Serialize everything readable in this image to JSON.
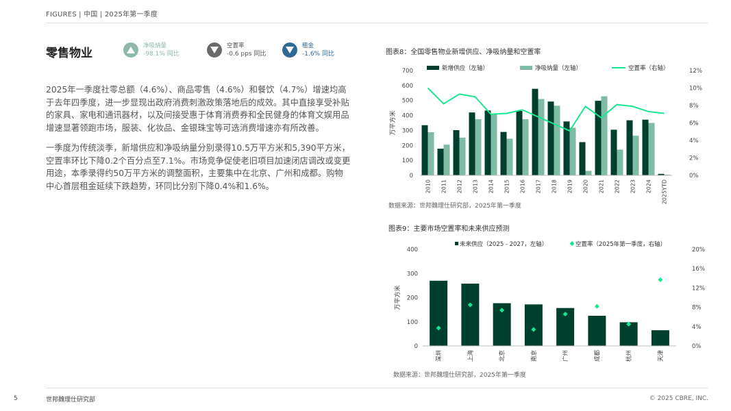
{
  "header": {
    "text": "FIGURES  | 中国 |  2025年第一季度"
  },
  "section_title": "零售物业",
  "kpis": [
    {
      "label": "净吸纳量",
      "value": "-98.1% 同比",
      "color": "#8fb8ad",
      "direction": "up"
    },
    {
      "label": "空置率",
      "value": "-0.6 pps 同比",
      "color": "#6b6b6b",
      "direction": "down"
    },
    {
      "label": "租金",
      "value": "-1.6% 同比",
      "color": "#2f6a96",
      "direction": "down"
    }
  ],
  "paragraphs": [
    "2025年一季度社零总额（4.6%）、商品零售（4.6%）和餐饮（4.7%）增速均高于去年四季度，进一步显现出政府消费刺激政策落地后的成效。其中直接享受补贴的家具、家电和通讯器材，以及间接受惠于体育消费券和全民健身的体育文娱用品增速显著领跑市场，服装、化妆品、金银珠宝等可选消费增速亦有所改善。",
    "一季度为传统淡季，新增供应和净吸纳量分别录得10.5万平方米和5,390平方米，空置率环比下降0.2个百分点至7.1%。市场竞争促使老旧项目加速闭店调改或变更用途，本季录得约50万平方米的调整面积，主要集中在北京、广州和成都。购物中心首层租金延续下跌趋势，环同比分别下降0.4%和1.6%。"
  ],
  "chart1": {
    "title": "图表8：全国零售物业新增供应、净吸纳量和空置率",
    "source": "数据来源：世邦魏理仕研究部，2025年第一季度"
  },
  "chart2": {
    "title": "图表9：主要市场空置率和未来供应预测",
    "source": "数据来源：世邦魏理仕研究部，2025年第一季度"
  },
  "footer": {
    "page": "5",
    "left": "世邦魏理仕研究部",
    "right": "© 2025 CBRE, INC."
  },
  "colors": {
    "dark_green": "#003f2d",
    "light_green": "#80bba6",
    "accent_green": "#17e88f"
  },
  "chart_data": [
    {
      "type": "bar",
      "title": "图表8：全国零售物业新增供应、净吸纳量和空置率",
      "categories": [
        "2010",
        "2011",
        "2012",
        "2013",
        "2014",
        "2015",
        "2016",
        "2017",
        "2018",
        "2019",
        "2020",
        "2021",
        "2022",
        "2023",
        "2024",
        "2025YTD"
      ],
      "series": [
        {
          "name": "新增供应（左轴）",
          "axis": "left",
          "type": "bar",
          "values": [
            335,
            178,
            302,
            420,
            433,
            290,
            430,
            578,
            493,
            360,
            222,
            498,
            305,
            368,
            372,
            10
          ]
        },
        {
          "name": "净吸纳量（左轴）",
          "axis": "left",
          "type": "bar",
          "values": [
            288,
            205,
            252,
            375,
            412,
            245,
            375,
            510,
            465,
            318,
            30,
            528,
            172,
            265,
            350,
            5
          ]
        },
        {
          "name": "空置率（右轴）",
          "axis": "right",
          "type": "line",
          "values": [
            10.0,
            8.2,
            9.3,
            9.0,
            7.0,
            7.1,
            7.5,
            6.7,
            5.9,
            5.1,
            7.9,
            6.6,
            8.1,
            7.9,
            7.3,
            7.1
          ]
        }
      ],
      "ylabel": "万平方米",
      "ylim": [
        0,
        700
      ],
      "y_ticks": [
        0,
        100,
        200,
        300,
        400,
        500,
        600,
        700
      ],
      "y2lim": [
        0,
        12
      ],
      "y2_ticks": [
        "0%",
        "2%",
        "4%",
        "6%",
        "8%",
        "10%",
        "12%"
      ],
      "legend": "top",
      "grid": false
    },
    {
      "type": "bar",
      "title": "图表9：主要市场空置率和未来供应预测",
      "categories": [
        "深圳",
        "上海",
        "北京",
        "南京",
        "广州",
        "成都",
        "杭州",
        "天津"
      ],
      "series": [
        {
          "name": "未来供应（2025 - 2027，左轴）",
          "axis": "left",
          "type": "bar",
          "values": [
            270,
            258,
            177,
            172,
            157,
            125,
            98,
            65
          ]
        },
        {
          "name": "空置率（2025年第一季度，右轴）",
          "axis": "right",
          "type": "scatter",
          "values": [
            3.7,
            8.5,
            7.4,
            3.4,
            6.6,
            8.2,
            4.5,
            13.7
          ]
        }
      ],
      "ylabel": "万平方米",
      "ylim": [
        0,
        400
      ],
      "y_ticks": [
        0,
        100,
        200,
        300,
        400
      ],
      "y2lim": [
        0,
        20
      ],
      "y2_ticks": [
        "0%",
        "4%",
        "8%",
        "12%",
        "16%",
        "20%"
      ],
      "legend": "top",
      "grid": false
    }
  ]
}
